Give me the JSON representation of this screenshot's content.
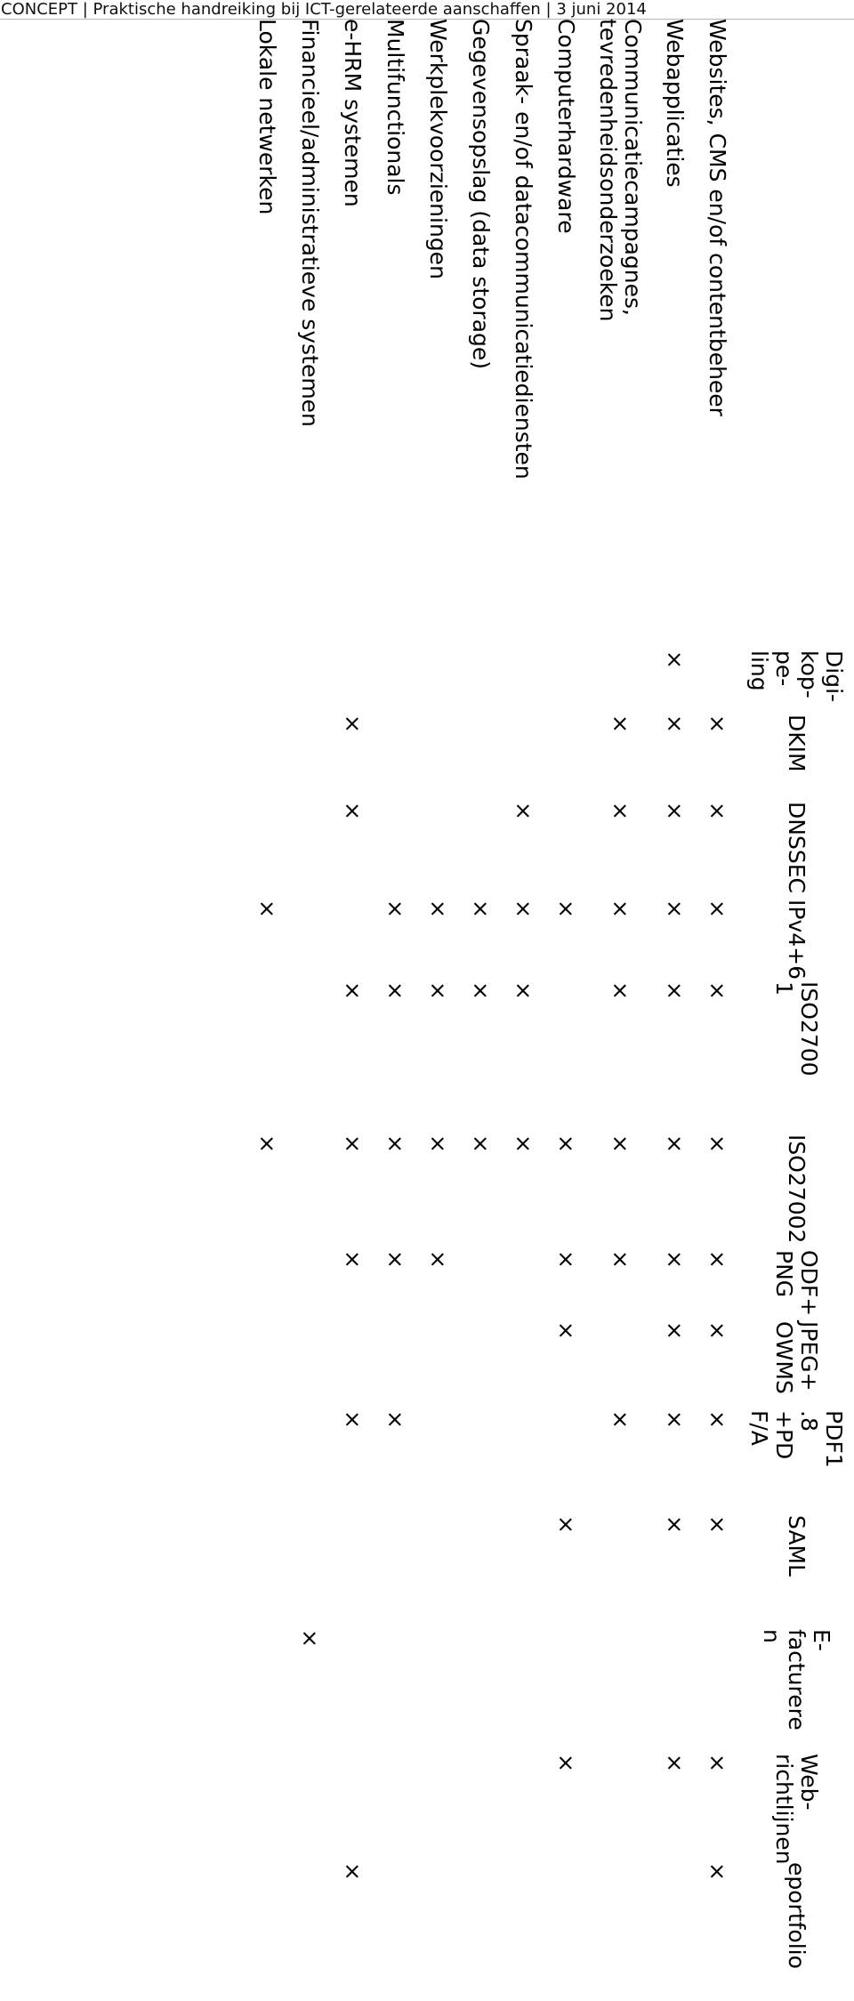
{
  "header": {
    "text": "CONCEPT | Praktische handreiking bij ICT-gerelateerde aanschaffen | 3 juni 2014"
  },
  "table": {
    "mark": "×",
    "empty": "",
    "corner_label": "",
    "columns": [
      {
        "id": "digikoppeling",
        "label": "Digi-\nkop-\npe-\nling",
        "full": "Digikoppeling"
      },
      {
        "id": "dkim",
        "label": "DKIM",
        "full": "DKIM"
      },
      {
        "id": "dnssec",
        "label": "DNSSEC",
        "full": "DNSSEC"
      },
      {
        "id": "ipv4-6",
        "label": "IPv4+6",
        "full": "IPv4+6"
      },
      {
        "id": "iso27001",
        "label": "ISO2700\n1",
        "full": "ISO27001"
      },
      {
        "id": "iso27002",
        "label": "ISO27002",
        "full": "ISO27002"
      },
      {
        "id": "odf-png",
        "label": "ODF+\nPNG",
        "full": "ODF+ PNG"
      },
      {
        "id": "jpeg-owms",
        "label": "JPEG+\nOWMS",
        "full": "JPEG+ OWMS"
      },
      {
        "id": "pdf-pdfa",
        "label": "PDF1\n.8\n+PD\nF/A",
        "full": "PDF1.8 +PDF/A"
      },
      {
        "id": "saml",
        "label": "SAML",
        "full": "SAML"
      },
      {
        "id": "e-factureren",
        "label": "E-\nfacturere\nn",
        "full": "E-factureren"
      },
      {
        "id": "webrichtlijnen",
        "label": "Web-\nrichtlijnen",
        "full": "Webrichtlijnen"
      },
      {
        "id": "eportfolio",
        "label": "eportfolio",
        "full": "eportfolio"
      }
    ],
    "rows": [
      {
        "id": "websites-cms",
        "label": "Websites, CMS en/of contentbeheer",
        "tall": false,
        "marks": [
          0,
          1,
          1,
          1,
          1,
          1,
          1,
          1,
          1,
          1,
          0,
          1,
          1
        ]
      },
      {
        "id": "webapplicaties",
        "label": "Webapplicaties",
        "tall": false,
        "marks": [
          1,
          1,
          1,
          1,
          1,
          1,
          1,
          1,
          1,
          1,
          0,
          1,
          0
        ]
      },
      {
        "id": "communicatiecampagnes",
        "label": "Communicatiecampagnes,\ntevredenheidsonderzoeken",
        "tall": true,
        "marks": [
          0,
          1,
          1,
          1,
          1,
          1,
          1,
          0,
          1,
          0,
          0,
          0,
          0
        ]
      },
      {
        "id": "computerhardware",
        "label": "Computerhardware",
        "tall": false,
        "marks": [
          0,
          0,
          0,
          1,
          0,
          1,
          1,
          1,
          0,
          1,
          0,
          1,
          0
        ]
      },
      {
        "id": "spraak-datacommunicatie",
        "label": "Spraak- en/of datacommunicatiediensten",
        "tall": false,
        "marks": [
          0,
          0,
          1,
          1,
          1,
          1,
          0,
          0,
          0,
          0,
          0,
          0,
          0
        ]
      },
      {
        "id": "gegevensopslag",
        "label": "Gegevensopslag (data storage)",
        "tall": false,
        "marks": [
          0,
          0,
          0,
          1,
          1,
          1,
          0,
          0,
          0,
          0,
          0,
          0,
          0
        ]
      },
      {
        "id": "werkplekvoorzieningen",
        "label": "Werkplekvoorzieningen",
        "tall": false,
        "marks": [
          0,
          0,
          0,
          1,
          1,
          1,
          1,
          0,
          0,
          0,
          0,
          0,
          0
        ]
      },
      {
        "id": "multifunctionals",
        "label": "Multifunctionals",
        "tall": false,
        "marks": [
          0,
          0,
          0,
          1,
          1,
          1,
          1,
          0,
          1,
          0,
          0,
          0,
          0
        ]
      },
      {
        "id": "e-hrm-systemen",
        "label": "e-HRM systemen",
        "tall": false,
        "marks": [
          0,
          1,
          1,
          0,
          1,
          1,
          1,
          0,
          1,
          0,
          0,
          0,
          1
        ]
      },
      {
        "id": "financieel-administratief",
        "label": "Financieel/administratieve systemen",
        "tall": false,
        "marks": [
          0,
          0,
          0,
          0,
          0,
          0,
          0,
          0,
          0,
          0,
          1,
          0,
          0
        ]
      },
      {
        "id": "lokale-netwerken",
        "label": "Lokale netwerken",
        "tall": false,
        "marks": [
          0,
          0,
          0,
          1,
          0,
          1,
          0,
          0,
          0,
          0,
          0,
          0,
          0
        ]
      }
    ]
  }
}
